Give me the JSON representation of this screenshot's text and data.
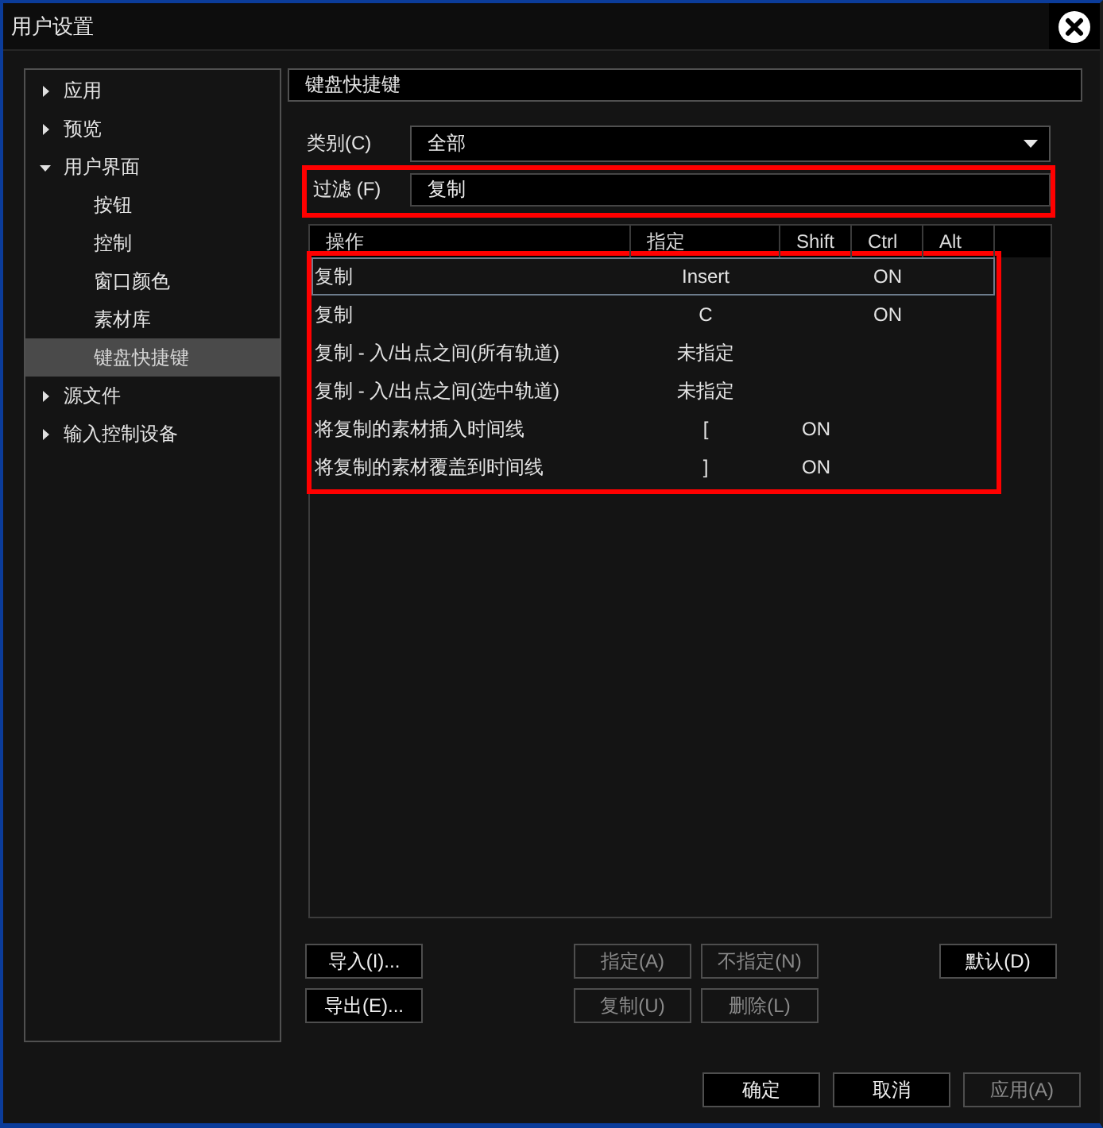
{
  "window": {
    "title": "用户设置"
  },
  "sidebar": {
    "items": [
      {
        "label": "应用",
        "expanded": false,
        "selected": false
      },
      {
        "label": "预览",
        "expanded": false,
        "selected": false
      },
      {
        "label": "用户界面",
        "expanded": true,
        "selected": false,
        "children": [
          {
            "label": "按钮",
            "selected": false
          },
          {
            "label": "控制",
            "selected": false
          },
          {
            "label": "窗口颜色",
            "selected": false
          },
          {
            "label": "素材库",
            "selected": false
          },
          {
            "label": "键盘快捷键",
            "selected": true
          }
        ]
      },
      {
        "label": "源文件",
        "expanded": false,
        "selected": false
      },
      {
        "label": "输入控制设备",
        "expanded": false,
        "selected": false
      }
    ]
  },
  "section": {
    "title": "键盘快捷键"
  },
  "category": {
    "label": "类别(C)",
    "value": "全部"
  },
  "filter": {
    "label": "过滤 (F)",
    "value": "复制",
    "highlighted": true
  },
  "table": {
    "highlighted": true,
    "columns": [
      "操作",
      "指定",
      "Shift",
      "Ctrl",
      "Alt"
    ],
    "rows": [
      {
        "action": "复制",
        "shortcut": "Insert",
        "ctrl": "ON",
        "selected": true
      },
      {
        "action": "复制",
        "shortcut": "C",
        "ctrl": "ON",
        "selected": false
      },
      {
        "action": "复制 - 入/出点之间(所有轨道)",
        "shortcut": "未指定",
        "selected": false
      },
      {
        "action": "复制 - 入/出点之间(选中轨道)",
        "shortcut": "未指定",
        "selected": false
      },
      {
        "action": "将复制的素材插入时间线",
        "shortcut": "[",
        "shift": "ON",
        "selected": false
      },
      {
        "action": "将复制的素材覆盖到时间线",
        "shortcut": "]",
        "shift": "ON",
        "selected": false
      }
    ]
  },
  "buttons": {
    "import": {
      "label": "导入(I)...",
      "disabled": false
    },
    "export": {
      "label": "导出(E)...",
      "disabled": false
    },
    "assign": {
      "label": "指定(A)",
      "disabled": true
    },
    "unassign": {
      "label": "不指定(N)",
      "disabled": true
    },
    "copy": {
      "label": "复制(U)",
      "disabled": true
    },
    "delete": {
      "label": "删除(L)",
      "disabled": true
    },
    "default": {
      "label": "默认(D)",
      "disabled": false
    }
  },
  "footer": {
    "ok": {
      "label": "确定",
      "disabled": false
    },
    "cancel": {
      "label": "取消",
      "disabled": false
    },
    "apply": {
      "label": "应用(A)",
      "disabled": true
    }
  }
}
